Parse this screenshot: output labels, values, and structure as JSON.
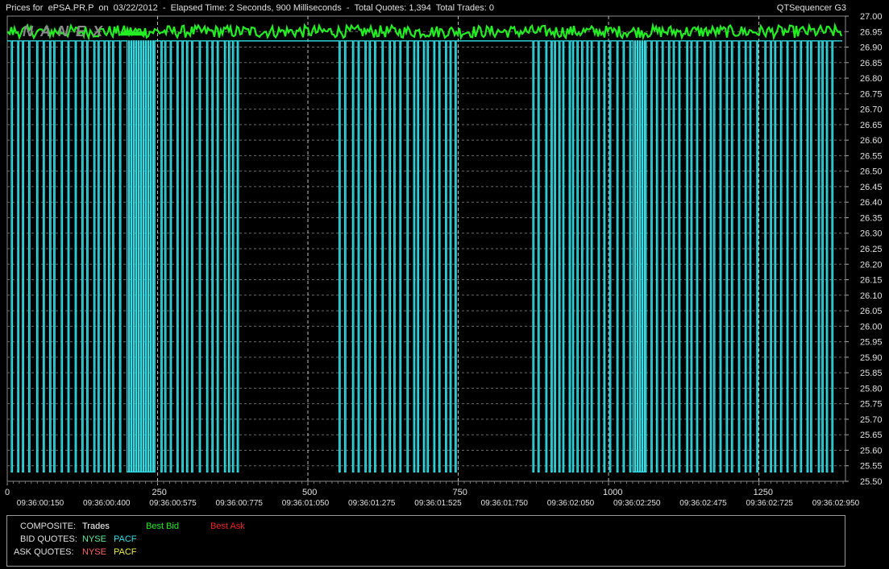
{
  "header": {
    "title": "Prices for  ePSA.PR.P  on  03/22/2012  -  Elapsed Time: 2 Seconds, 900 Milliseconds  -  Total Quotes: 1,394  Total Trades: 0",
    "app_name": "QTSequencer G3"
  },
  "watermark": "NANEX",
  "legend": {
    "composite_label": "COMPOSITE:",
    "trades": "Trades",
    "best_bid": "Best Bid",
    "best_ask": "Best Ask",
    "bid_quotes_label": "BID QUOTES:",
    "ask_quotes_label": "ASK QUOTES:",
    "nyse": "NYSE",
    "pacf": "PACF"
  },
  "colors": {
    "background": "#000000",
    "best_bid": "#22ee22",
    "pacf_bid": "#33e0e8",
    "nyse_bid": "#66ee99",
    "best_ask": "#ee2222",
    "nyse_ask": "#ff6666",
    "pacf_ask": "#eeee44",
    "trades": "#ffffff",
    "grid": "#6a6a6a",
    "axis_text": "#e0e0e0"
  },
  "chart_data": {
    "type": "line",
    "x_ticks": [
      0,
      250,
      500,
      750,
      1000,
      1250
    ],
    "xlim": [
      0,
      1394
    ],
    "time_labels": [
      "09:36:00:150",
      "09:36:00:400",
      "09:36:00:575",
      "09:36:00:775",
      "09:36:01:050",
      "09:36:01:275",
      "09:36:01:525",
      "09:36:01:750",
      "09:36:02:050",
      "09:36:02:250",
      "09:36:02:475",
      "09:36:02:725",
      "09:36:02:950"
    ],
    "y_ticks": [
      "27.00",
      "26.95",
      "26.90",
      "26.85",
      "26.80",
      "26.75",
      "26.70",
      "26.65",
      "26.60",
      "26.55",
      "26.50",
      "26.45",
      "26.40",
      "26.35",
      "26.30",
      "26.25",
      "26.20",
      "26.15",
      "26.10",
      "26.05",
      "26.00",
      "25.95",
      "25.90",
      "25.85",
      "25.80",
      "25.75",
      "25.70",
      "25.65",
      "25.60",
      "25.55",
      "25.50"
    ],
    "ylim": [
      25.5,
      27.0
    ],
    "series": [
      {
        "name": "Best Bid",
        "color": "#22ee22",
        "typical_value": 26.95,
        "range": [
          26.93,
          26.97
        ]
      },
      {
        "name": "PACF",
        "color": "#33e0e8",
        "typical_value": 26.92,
        "low_value": 25.53,
        "oscillation_count": 210
      }
    ]
  }
}
